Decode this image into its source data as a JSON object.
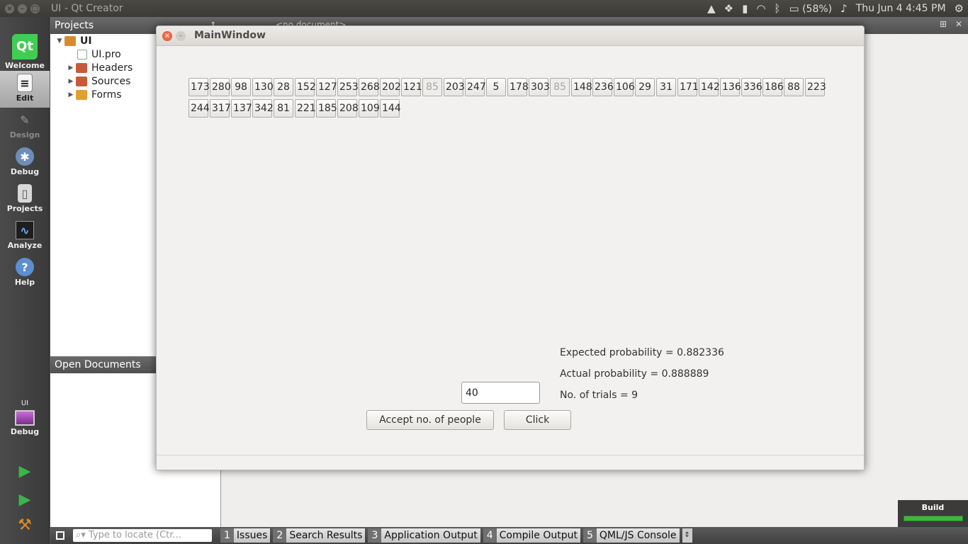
{
  "os": {
    "window_title": "UI - Qt Creator",
    "battery": "(58%)",
    "datetime": "Thu Jun  4  4:45 PM"
  },
  "modes": [
    {
      "label": "Welcome",
      "icon": "qt-logo-icon"
    },
    {
      "label": "Edit",
      "icon": "edit-document-icon"
    },
    {
      "label": "Design",
      "icon": "design-pen-icon"
    },
    {
      "label": "Debug",
      "icon": "debug-bug-icon"
    },
    {
      "label": "Projects",
      "icon": "projects-folder-icon"
    },
    {
      "label": "Analyze",
      "icon": "analyze-chart-icon"
    },
    {
      "label": "Help",
      "icon": "help-question-icon"
    }
  ],
  "kit": {
    "project": "UI",
    "config": "Debug"
  },
  "projects_pane": {
    "header": "Projects",
    "tree": [
      {
        "label": "UI",
        "bold": true
      },
      {
        "label": "UI.pro"
      },
      {
        "label": "Headers"
      },
      {
        "label": "Sources"
      },
      {
        "label": "Forms"
      }
    ]
  },
  "open_documents": {
    "header": "Open Documents"
  },
  "editor": {
    "placeholder": "<no document>"
  },
  "bottom": {
    "locate_placeholder": "Type to locate (Ctr...",
    "tabs": [
      {
        "num": "1",
        "label": "Issues"
      },
      {
        "num": "2",
        "label": "Search Results"
      },
      {
        "num": "3",
        "label": "Application Output"
      },
      {
        "num": "4",
        "label": "Compile Output"
      },
      {
        "num": "5",
        "label": "QML/JS Console"
      }
    ],
    "build_label": "Build"
  },
  "mainwindow": {
    "title": "MainWindow",
    "numbers_row1": [
      "173",
      "280",
      "98",
      "130",
      "28",
      "152",
      "127",
      "253",
      "268",
      "202",
      "121",
      "85",
      "203",
      "247",
      "5",
      "178",
      "303",
      "85",
      "148",
      "236",
      "106",
      "29",
      "31",
      "171",
      "142",
      "136",
      "336",
      "186",
      "88",
      "223"
    ],
    "numbers_row2": [
      "244",
      "317",
      "137",
      "342",
      "81",
      "221",
      "185",
      "208",
      "109",
      "144"
    ],
    "disabled_row1_indices": [
      11,
      17
    ],
    "input_value": "40",
    "accept_button": "Accept no. of people",
    "click_button": "Click",
    "expected": "Expected probability = 0.882336",
    "actual": "Actual probability = 0.888889",
    "trials": "No. of trials = 9"
  }
}
